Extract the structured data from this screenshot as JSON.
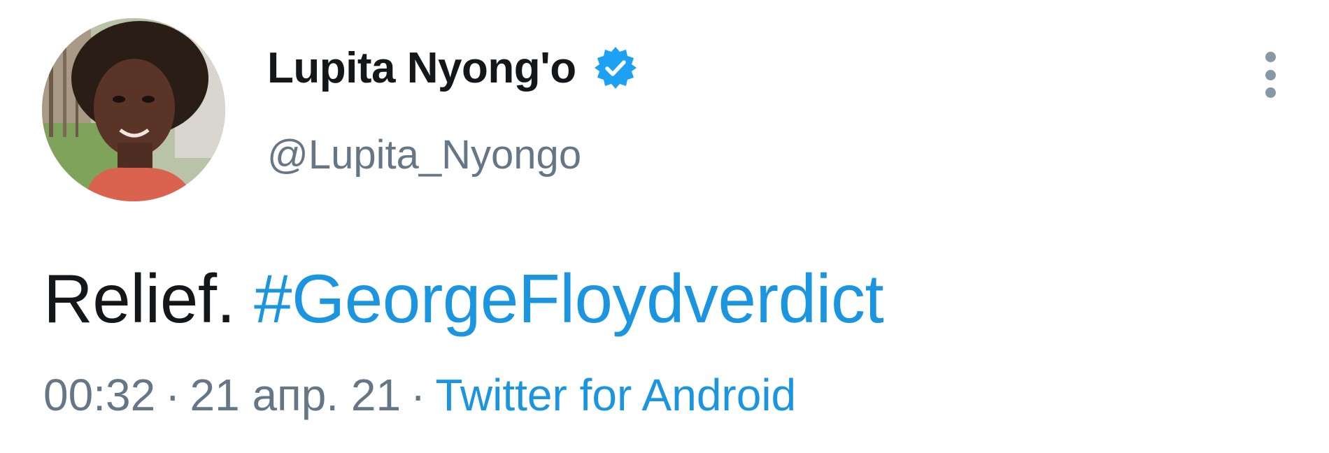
{
  "author": {
    "display_name": "Lupita Nyong'o",
    "handle": "@Lupita_Nyongo",
    "verified": true,
    "avatar_icon": "profile-photo"
  },
  "menu": {
    "icon": "more-vertical-icon"
  },
  "tweet": {
    "text": "Relief.",
    "hashtag": "#GeorgeFloydverdict"
  },
  "meta": {
    "time": "00:32",
    "separator": "·",
    "date": "21 апр. 21",
    "source": "Twitter for Android"
  },
  "colors": {
    "text": "#14171a",
    "secondary": "#657786",
    "link": "#1b95e0",
    "verified": "#1da1f2",
    "menu_dots": "#8899a6"
  }
}
